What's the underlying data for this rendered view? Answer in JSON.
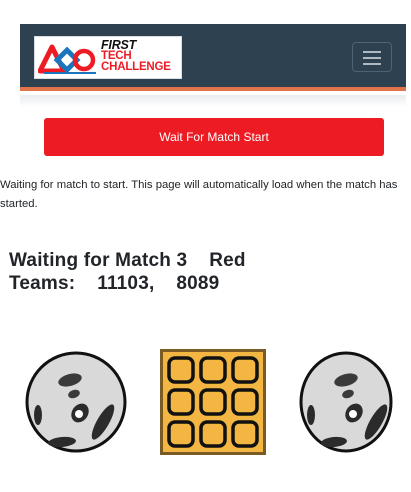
{
  "header": {
    "logo": {
      "line1": "FIRST",
      "line2": "TECH",
      "line3": "CHALLENGE"
    },
    "menu_icon": "hamburger-icon",
    "colors": {
      "navbar": "#2e4150",
      "accent_stripe": "#e0734a"
    }
  },
  "main": {
    "wait_button_label": "Wait For Match Start",
    "info_text": "Waiting for match to start. This page will automatically load when the match has started.",
    "match_title": "Waiting for Match 3    Red",
    "teams_line": "Teams:    11103,    8089",
    "colors": {
      "button": "#ed1c24"
    }
  },
  "images": [
    {
      "name": "cargo-ball-left",
      "icon": "wiffle-ball-icon"
    },
    {
      "name": "duck-box",
      "icon": "waffle-grid-icon"
    },
    {
      "name": "cargo-ball-right",
      "icon": "wiffle-ball-icon"
    }
  ]
}
